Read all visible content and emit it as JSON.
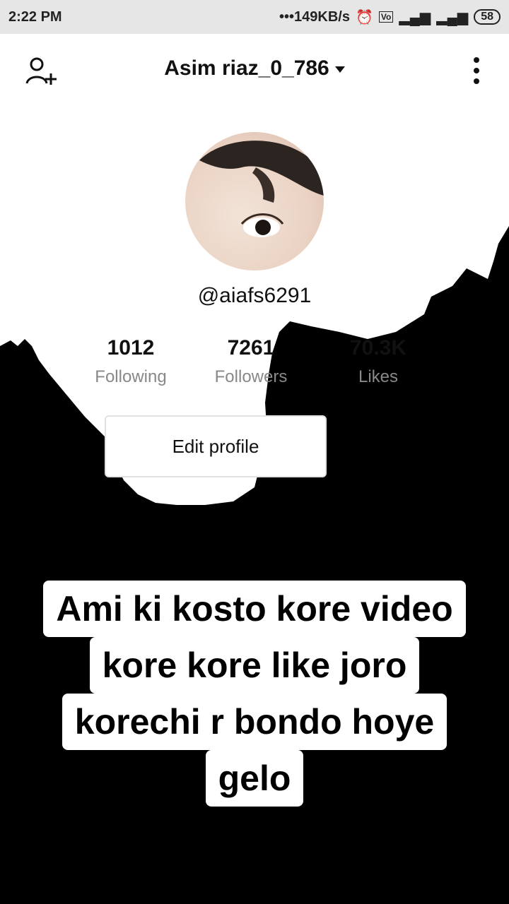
{
  "status_bar": {
    "time": "2:22 PM",
    "speed": "•••149KB/s",
    "battery": "58"
  },
  "header": {
    "username": "Asim riaz_0_786"
  },
  "profile": {
    "handle": "@aiafs6291"
  },
  "stats": [
    {
      "value": "1012",
      "label": "Following"
    },
    {
      "value": "7261",
      "label": "Followers"
    },
    {
      "value": "70.3K",
      "label": "Likes"
    }
  ],
  "actions": {
    "edit_profile": "Edit profile"
  },
  "caption": {
    "line1": "Ami ki kosto kore video",
    "line2": "kore  kore like joro",
    "line3": "korechi r bondo hoye",
    "line4": "gelo"
  }
}
